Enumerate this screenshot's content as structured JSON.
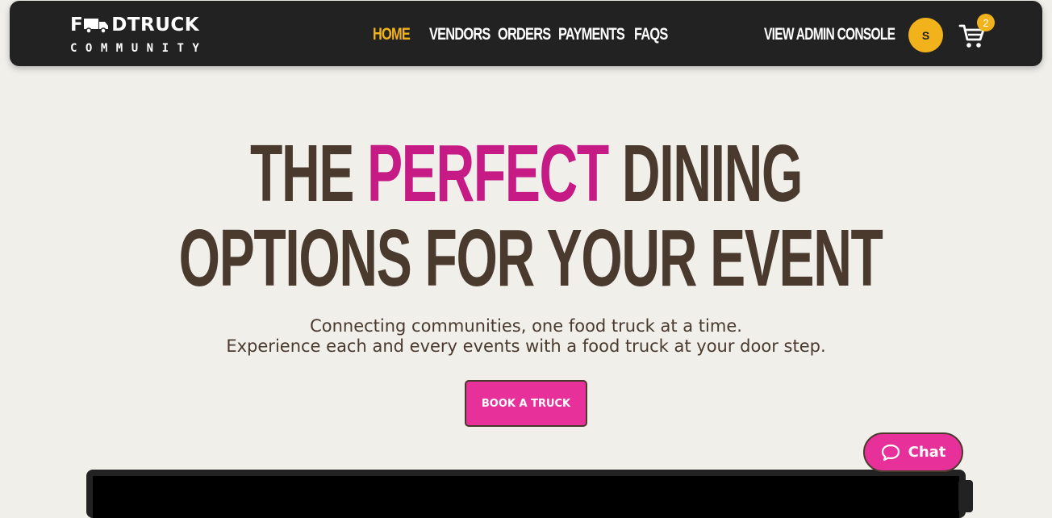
{
  "brand": {
    "logo_main_prefix": "F",
    "logo_main_suffix": "DTRUCK",
    "logo_sub": "COMMUNITY"
  },
  "nav": {
    "items": [
      {
        "label": "HOME",
        "active": true
      },
      {
        "label": "VENDORS",
        "active": false
      },
      {
        "label": "ORDERS",
        "active": false
      },
      {
        "label": "PAYMENTS",
        "active": false
      },
      {
        "label": "FAQS",
        "active": false
      }
    ],
    "admin_label": "VIEW ADMIN CONSOLE",
    "avatar_initial": "S",
    "cart_count": "2"
  },
  "hero": {
    "title_line1_a": "THE ",
    "title_line1_accent": "PERFECT",
    "title_line1_b": " DINING",
    "title_line2": "OPTIONS FOR YOUR EVENT",
    "subtitle_line1": "Connecting communities, one food truck at a time.",
    "subtitle_line2": "Experience each and every events with a food truck at your door step.",
    "cta_label": "BOOK A TRUCK"
  },
  "chat": {
    "label": "Chat"
  },
  "colors": {
    "background": "#f0efea",
    "navbar": "#222222",
    "accent_yellow": "#f2b21b",
    "accent_pink": "#e8309a",
    "title_pink": "#c61a84",
    "text_brown": "#4a3a2e"
  },
  "icons": [
    "truck-icon",
    "cart-icon",
    "chat-bubble-icon"
  ]
}
